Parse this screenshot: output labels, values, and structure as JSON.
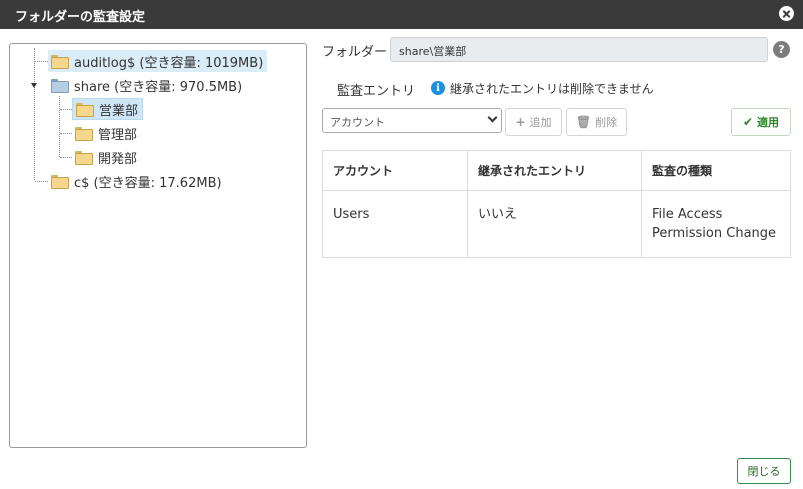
{
  "title": "フォルダーの監査設定",
  "tree": {
    "nodes": [
      {
        "label": "auditlog$ (空き容量: 1019MB)"
      },
      {
        "label": "share (空き容量: 970.5MB)"
      },
      {
        "label": "営業部"
      },
      {
        "label": "管理部"
      },
      {
        "label": "開発部"
      },
      {
        "label": "c$ (空き容量: 17.62MB)"
      }
    ]
  },
  "folder": {
    "label": "フォルダー",
    "value": "share\\営業部"
  },
  "audit_entries": {
    "label": "監査エントリ",
    "info": "継承されたエントリは削除できません",
    "account_select": "アカウント",
    "add_label": "追加",
    "delete_label": "削除",
    "apply_label": "適用"
  },
  "table": {
    "headers": [
      "アカウント",
      "継承されたエントリ",
      "監査の種類"
    ],
    "rows": [
      {
        "account": "Users",
        "inherited": "いいえ",
        "type_line1": "File Access",
        "type_line2": "Permission Change"
      }
    ]
  },
  "close_label": "閉じる",
  "colors": {
    "titlebar": "#3a3a3a",
    "accent": "#2a8a2a",
    "info": "#1a8fe3"
  }
}
